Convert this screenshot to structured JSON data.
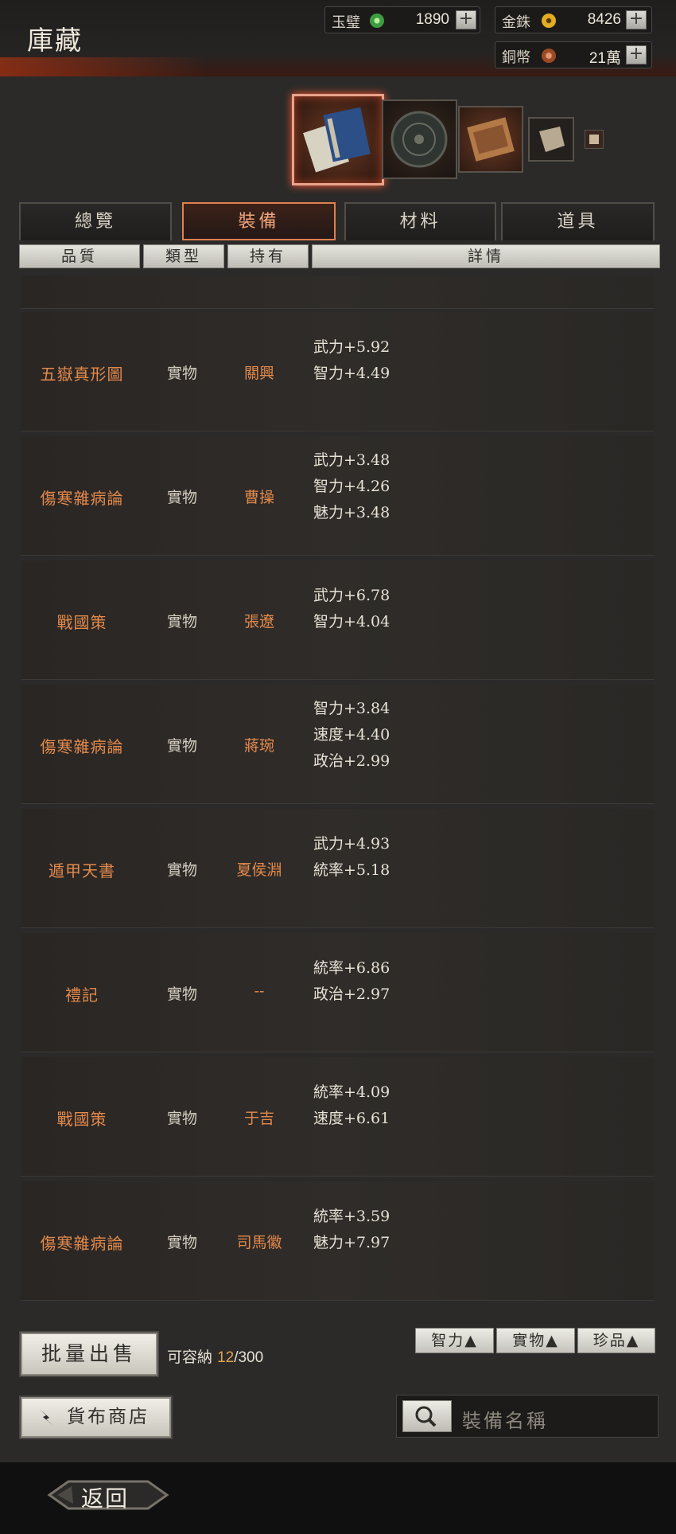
{
  "title": "庫藏",
  "currencies": [
    {
      "label": "玉璧",
      "value": "1890",
      "icon": "jade-coin-icon",
      "color": "#4fbf5a"
    },
    {
      "label": "金銖",
      "value": "8426",
      "icon": "gold-coin-icon",
      "color": "#d8a21c"
    },
    {
      "label": "銅幣",
      "value": "21萬",
      "icon": "copper-coin-icon",
      "color": "#b0623a"
    }
  ],
  "plus_label": "+",
  "tabs": [
    "總覽",
    "裝備",
    "材料",
    "道具"
  ],
  "active_tab": "裝備",
  "columns": [
    "品質",
    "類型",
    "持有",
    "詳情"
  ],
  "items": [
    {
      "quality": "五嶽真形圖",
      "type": "實物",
      "owner": "關興",
      "stats": [
        "武力+5.92",
        "智力+4.49"
      ]
    },
    {
      "quality": "傷寒雜病論",
      "type": "實物",
      "owner": "曹操",
      "stats": [
        "武力+3.48",
        "智力+4.26",
        "魅力+3.48"
      ]
    },
    {
      "quality": "戰國策",
      "type": "實物",
      "owner": "張遼",
      "stats": [
        "武力+6.78",
        "智力+4.04"
      ]
    },
    {
      "quality": "傷寒雜病論",
      "type": "實物",
      "owner": "蔣琬",
      "stats": [
        "智力+3.84",
        "速度+4.40",
        "政治+2.99"
      ]
    },
    {
      "quality": "遁甲天書",
      "type": "實物",
      "owner": "夏侯淵",
      "stats": [
        "武力+4.93",
        "統率+5.18"
      ]
    },
    {
      "quality": "禮記",
      "type": "實物",
      "owner": "--",
      "stats": [
        "統率+6.86",
        "政治+2.97"
      ]
    },
    {
      "quality": "戰國策",
      "type": "實物",
      "owner": "于吉",
      "stats": [
        "統率+4.09",
        "速度+6.61"
      ]
    },
    {
      "quality": "傷寒雜病論",
      "type": "實物",
      "owner": "司馬徽",
      "stats": [
        "統率+3.59",
        "魅力+7.97"
      ]
    }
  ],
  "batch_sell": "批量出售",
  "capacity": {
    "label": "可容納",
    "used": "12",
    "total": "/300"
  },
  "sort_buttons": [
    "智力▲",
    "實物▲",
    "珍品▲"
  ],
  "shop_button": "貨布商店",
  "search_placeholder": "裝備名稱",
  "back_label": "返回"
}
